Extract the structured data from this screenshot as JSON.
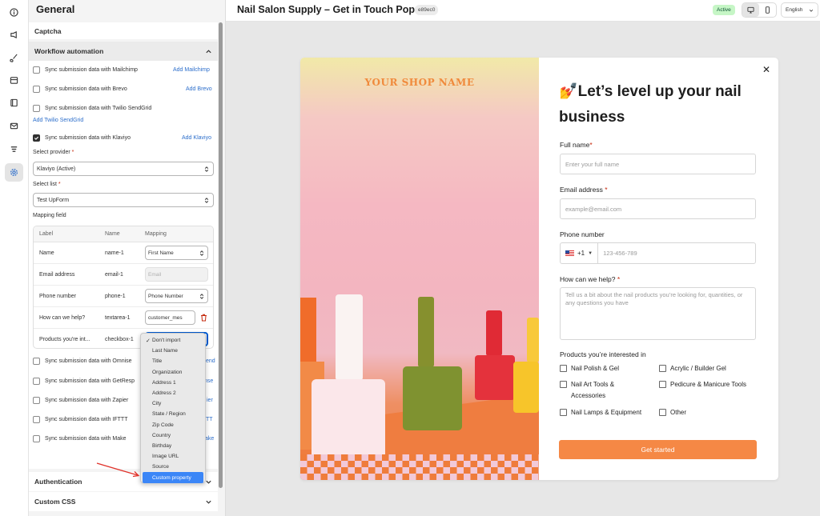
{
  "header": {
    "title": "Nail Salon Supply – Get in Touch Popup",
    "id_badge": "e89ec0",
    "status": "Active",
    "language": "English"
  },
  "panel": {
    "title": "General",
    "captcha_label": "Captcha",
    "workflow_label": "Workflow automation",
    "authentication_label": "Authentication",
    "custom_css_label": "Custom CSS"
  },
  "integrations": [
    {
      "label": "Sync submission data with Mailchimp",
      "link": "Add Mailchimp",
      "checked": false
    },
    {
      "label": "Sync submission data with Brevo",
      "link": "Add Brevo",
      "checked": false
    },
    {
      "label": "Sync submission data with Twilio SendGrid",
      "link": "Add Twilio SendGrid",
      "checked": false
    },
    {
      "label": "Sync submission data with Klaviyo",
      "link": "Add Klaviyo",
      "checked": true
    },
    {
      "label": "Sync submission data with Omnise",
      "link": "end",
      "checked": false
    },
    {
      "label": "Sync submission data with GetResp",
      "link": "nse",
      "checked": false
    },
    {
      "label": "Sync submission data with Zapier",
      "link": "ier",
      "checked": false
    },
    {
      "label": "Sync submission data with IFTTT",
      "link": "TT",
      "checked": false
    },
    {
      "label": "Sync submission data with Make",
      "link": "ake",
      "checked": false
    }
  ],
  "klaviyo": {
    "provider_label": "Select provider",
    "provider_value": "Klaviyo (Active)",
    "list_label": "Select list",
    "list_value": "Test UpForm",
    "mapping_label": "Mapping field"
  },
  "mapping": {
    "headers": [
      "Label",
      "Name",
      "Mapping"
    ],
    "rows": [
      {
        "label": "Name",
        "name": "name-1",
        "mapping": "First Name"
      },
      {
        "label": "Email address",
        "name": "email-1",
        "mapping": "Email"
      },
      {
        "label": "Phone number",
        "name": "phone-1",
        "mapping": "Phone Number"
      },
      {
        "label": "How can we help?",
        "name": "textarea-1",
        "mapping": "customer_mes"
      },
      {
        "label": "Products you're int...",
        "name": "checkbox-1",
        "mapping": ""
      }
    ]
  },
  "dropdown": {
    "options": [
      "Don't import",
      "Last Name",
      "Title",
      "Organization",
      "Address 1",
      "Address 2",
      "City",
      "State / Region",
      "Zip Code",
      "Country",
      "Birthday",
      "Image URL",
      "Source",
      "Custom property"
    ],
    "checked": "Don't import",
    "highlighted": "Custom property"
  },
  "popup": {
    "shop_name": "YOUR SHOP NAME",
    "headline_emoji": "💅",
    "headline": "Let’s level up your nail business",
    "full_name_label": "Full name",
    "full_name_placeholder": "Enter your full name",
    "email_label": "Email address",
    "email_placeholder": "example@email.com",
    "phone_label": "Phone number",
    "phone_code": "+1",
    "phone_placeholder": "123-456-789",
    "help_label": "How can we help?",
    "help_placeholder": "Tell us a bit about the nail products you’re looking for, quantities, or any questions you have",
    "products_label": "Products you’re interested in",
    "products": [
      "Nail Polish & Gel",
      "Acrylic / Builder Gel",
      "Nail Art Tools & Accessories",
      "Pedicure & Manicure Tools",
      "Nail Lamps & Equipment",
      "Other"
    ],
    "submit": "Get started",
    "required_mark": "*"
  },
  "icons": {
    "rail": [
      "info-icon",
      "megaphone-icon",
      "brush-icon",
      "cart-icon",
      "book-icon",
      "mail-icon",
      "list-icon",
      "gear-icon"
    ]
  },
  "colors": {
    "accent_orange": "#f58845",
    "active_badge": "#c6f6c6",
    "link_blue": "#2c6ecb",
    "dropdown_highlight": "#3b86f7"
  }
}
